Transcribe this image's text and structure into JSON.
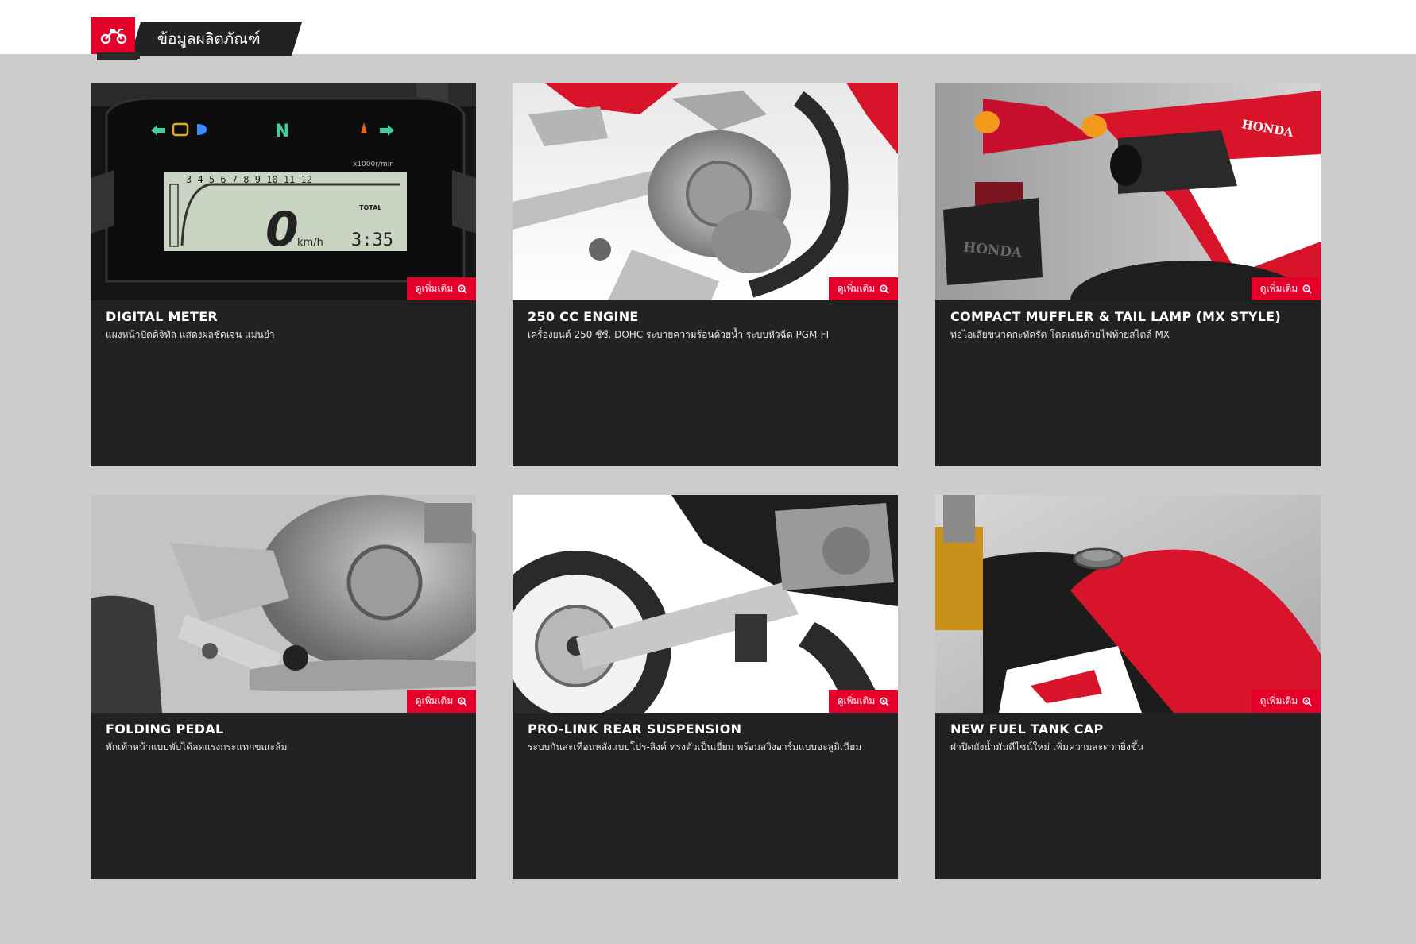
{
  "header": {
    "tab_label": "ข้อมูลผลิตภัณฑ์"
  },
  "more_label": "ดูเพิ่มเติม",
  "colors": {
    "accent": "#e4002b",
    "card_bg": "#222222",
    "page_bg": "#cccccc"
  },
  "cards": [
    {
      "title": "DIGITAL METER",
      "desc": "แผงหน้าปัดดิจิทัล แสดงผลชัดเจน แม่นยำ",
      "meter": {
        "gear": "N",
        "speed": "0",
        "unit": "km/h",
        "total": "TOTAL",
        "time": "3:35",
        "scale": "x1000r/min"
      }
    },
    {
      "title": "250 CC ENGINE",
      "desc": "เครื่องยนต์ 250 ซีซี. DOHC ระบายความร้อนด้วยน้ำ ระบบหัวฉีด PGM-FI"
    },
    {
      "title": "COMPACT MUFFLER & TAIL LAMP (MX STYLE)",
      "desc": "ท่อไอเสียขนาดกะทัดรัด โดดเด่นด้วยไฟท้ายสไตล์ MX",
      "brand": "HONDA"
    },
    {
      "title": "FOLDING PEDAL",
      "desc": "พักเท้าหน้าแบบพับได้ลดแรงกระแทกขณะล้ม"
    },
    {
      "title": "PRO-LINK REAR SUSPENSION",
      "desc": "ระบบกันสะเทือนหลังแบบโปร-ลิงค์ ทรงตัวเป็นเยี่ยม พร้อมสวิงอาร์มแบบอะลูมิเนียม"
    },
    {
      "title": "NEW FUEL TANK CAP",
      "desc": "ฝาปิดถังน้ำมันดีไซน์ใหม่ เพิ่มความสะดวกยิ่งขึ้น"
    }
  ]
}
